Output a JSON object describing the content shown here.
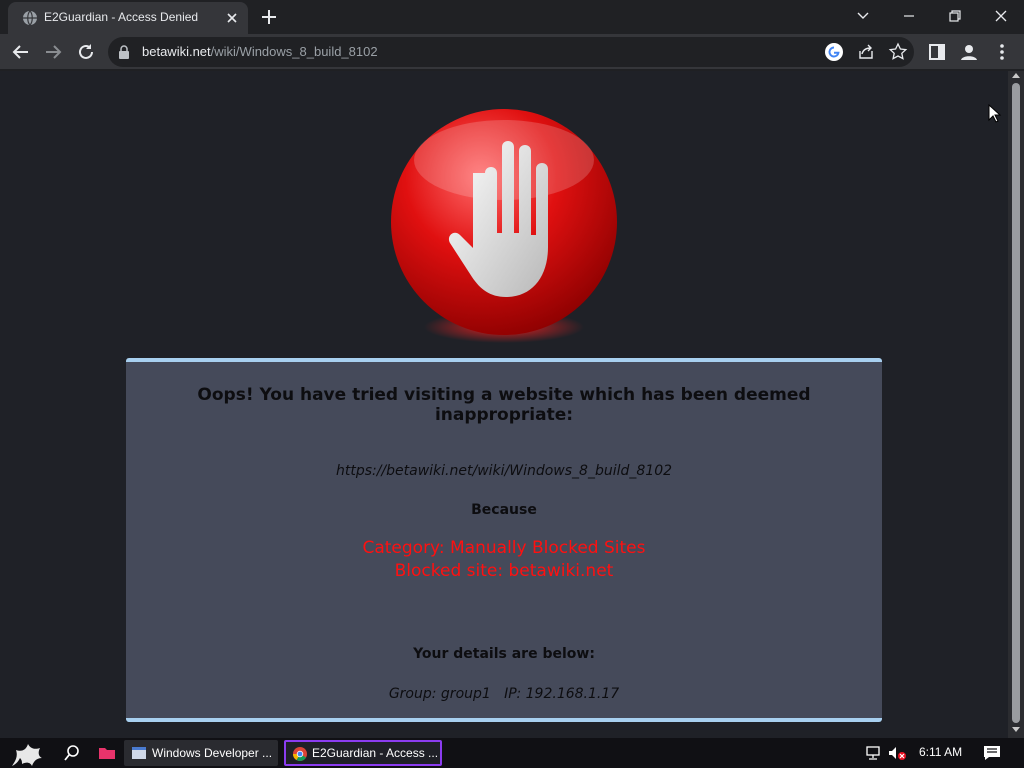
{
  "browser": {
    "tab": {
      "title": "E2Guardian - Access Denied"
    },
    "address": {
      "host": "betawiki.net",
      "path": "/wiki/Windows_8_build_8102"
    }
  },
  "page": {
    "heading": "Oops! You have tried visiting a website which has been deemed inappropriate:",
    "blocked_url": "https://betawiki.net/wiki/Windows_8_build_8102",
    "because_label": "Because",
    "reason_category": "Category: Manually Blocked Sites",
    "reason_site": "Blocked site: betawiki.net",
    "details_title": "Your details are below:",
    "details": "Group: group1   IP: 192.168.1.17"
  },
  "taskbar": {
    "items": [
      {
        "label": "Windows Developer ..."
      },
      {
        "label": "E2Guardian - Access ..."
      }
    ],
    "clock": "6:11 AM"
  },
  "colors": {
    "accent_border": "#a8d0f0",
    "panel_bg": "#454a5a",
    "reason_text": "#ff1010",
    "active_task_border": "#8b3cf0"
  }
}
